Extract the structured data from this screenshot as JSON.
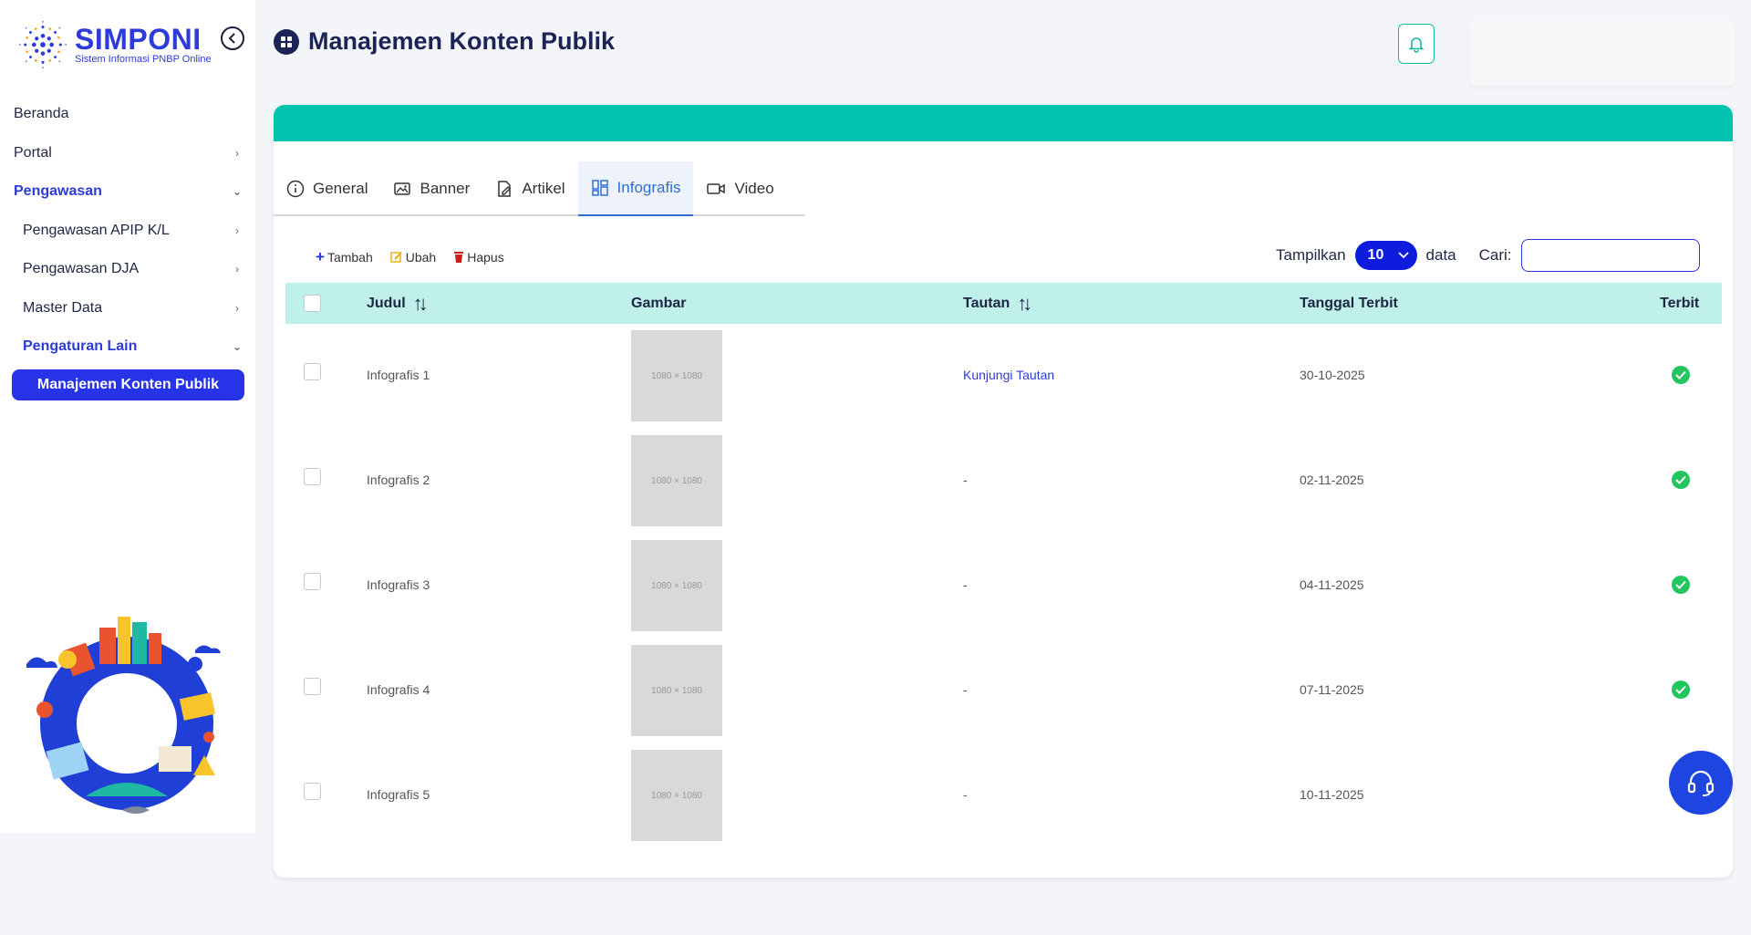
{
  "brand": {
    "title": "SIMPONI",
    "subtitle": "Sistem Informasi PNBP Online"
  },
  "sidebar": {
    "items": [
      {
        "label": "Beranda",
        "chevron": ""
      },
      {
        "label": "Portal",
        "chevron": "›"
      },
      {
        "label": "Pengawasan",
        "chevron": "⌄"
      },
      {
        "label": "Pengawasan APIP K/L",
        "chevron": "›"
      },
      {
        "label": "Pengawasan DJA",
        "chevron": "›"
      },
      {
        "label": "Master Data",
        "chevron": "›"
      },
      {
        "label": "Pengaturan Lain",
        "chevron": "⌄"
      }
    ],
    "active_item": "Manajemen Konten Publik"
  },
  "header": {
    "title": "Manajemen Konten Publik",
    "icon": "grid-icon"
  },
  "tabs": [
    {
      "label": "General",
      "icon": "info-icon"
    },
    {
      "label": "Banner",
      "icon": "image-icon"
    },
    {
      "label": "Artikel",
      "icon": "edit-icon"
    },
    {
      "label": "Infografis",
      "icon": "layout-icon"
    },
    {
      "label": "Video",
      "icon": "video-icon"
    }
  ],
  "toolbar": {
    "add": "Tambah",
    "edit": "Ubah",
    "delete": "Hapus"
  },
  "show": {
    "before": "Tampilkan",
    "value": "10",
    "after": "data",
    "search_label": "Cari:",
    "search_value": ""
  },
  "table": {
    "columns": {
      "title": "Judul",
      "image": "Gambar",
      "link": "Tautan",
      "date": "Tanggal Terbit",
      "published": "Terbit"
    },
    "rows": [
      {
        "title": "Infografis 1",
        "image": "1080 × 1080",
        "link": "Kunjungi Tautan",
        "date": "30-10-2025"
      },
      {
        "title": "Infografis 2",
        "image": "1080 × 1080",
        "link": "-",
        "date": "02-11-2025"
      },
      {
        "title": "Infografis 3",
        "image": "1080 × 1080",
        "link": "-",
        "date": "04-11-2025"
      },
      {
        "title": "Infografis 4",
        "image": "1080 × 1080",
        "link": "-",
        "date": "07-11-2025"
      },
      {
        "title": "Infografis 5",
        "image": "1080 × 1080",
        "link": "-",
        "date": "10-11-2025"
      }
    ]
  },
  "colors": {
    "primary": "#2733e6",
    "teal": "#03c4ae",
    "header_bg": "#bff0ea",
    "success": "#22c55e"
  }
}
